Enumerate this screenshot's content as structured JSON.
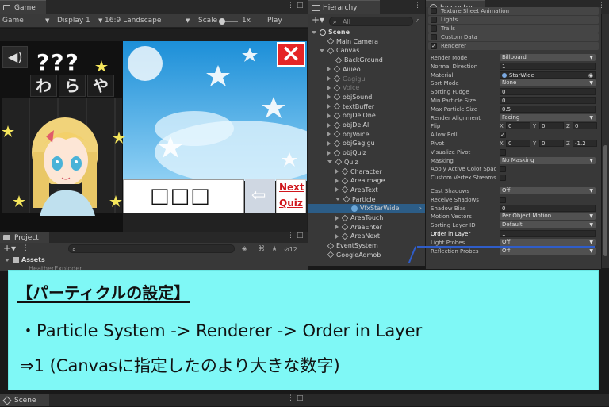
{
  "game": {
    "tab": "Game",
    "mode": "Game",
    "display": "Display 1",
    "aspect": "16:9 Landscape",
    "scale_label": "Scale",
    "scale_value": "1x",
    "play": "Play Focuse",
    "question": "???",
    "kana": [
      "わ",
      "ら",
      "や"
    ],
    "close": "×",
    "box": "□□□",
    "next1": "Next",
    "next2": "Quiz"
  },
  "hierarchy": {
    "tab": "Hierarchy",
    "search": "All",
    "items": [
      {
        "label": "Scene",
        "indent": 0,
        "arrow": "down",
        "icon": "unity",
        "bold": true,
        "dim": false
      },
      {
        "label": "Main Camera",
        "indent": 1,
        "arrow": "",
        "icon": "cube",
        "bold": false,
        "dim": false
      },
      {
        "label": "Canvas",
        "indent": 1,
        "arrow": "down",
        "icon": "cube",
        "bold": false,
        "dim": false
      },
      {
        "label": "BackGround",
        "indent": 2,
        "arrow": "",
        "icon": "cube",
        "bold": false,
        "dim": false
      },
      {
        "label": "Aiueo",
        "indent": 2,
        "arrow": "right",
        "icon": "cube",
        "bold": false,
        "dim": false
      },
      {
        "label": "Gagigu",
        "indent": 2,
        "arrow": "right",
        "icon": "cube",
        "bold": false,
        "dim": true
      },
      {
        "label": "Voice",
        "indent": 2,
        "arrow": "right",
        "icon": "cube",
        "bold": false,
        "dim": true
      },
      {
        "label": "objSound",
        "indent": 2,
        "arrow": "right",
        "icon": "cube",
        "bold": false,
        "dim": false
      },
      {
        "label": "textBuffer",
        "indent": 2,
        "arrow": "right",
        "icon": "cube",
        "bold": false,
        "dim": false
      },
      {
        "label": "objDelOne",
        "indent": 2,
        "arrow": "right",
        "icon": "cube",
        "bold": false,
        "dim": false
      },
      {
        "label": "objDelAll",
        "indent": 2,
        "arrow": "right",
        "icon": "cube",
        "bold": false,
        "dim": false
      },
      {
        "label": "objVoice",
        "indent": 2,
        "arrow": "right",
        "icon": "cube",
        "bold": false,
        "dim": false
      },
      {
        "label": "objGagigu",
        "indent": 2,
        "arrow": "right",
        "icon": "cube",
        "bold": false,
        "dim": false
      },
      {
        "label": "objQuiz",
        "indent": 2,
        "arrow": "right",
        "icon": "cube",
        "bold": false,
        "dim": false
      },
      {
        "label": "Quiz",
        "indent": 2,
        "arrow": "down",
        "icon": "cube",
        "bold": false,
        "dim": false
      },
      {
        "label": "Character",
        "indent": 3,
        "arrow": "right",
        "icon": "cube",
        "bold": false,
        "dim": false
      },
      {
        "label": "AreaImage",
        "indent": 3,
        "arrow": "right",
        "icon": "cube",
        "bold": false,
        "dim": false
      },
      {
        "label": "AreaText",
        "indent": 3,
        "arrow": "right",
        "icon": "cube",
        "bold": false,
        "dim": false
      },
      {
        "label": "Particle",
        "indent": 3,
        "arrow": "down",
        "icon": "cube",
        "bold": false,
        "dim": false
      },
      {
        "label": "VfxStarWide",
        "indent": 4,
        "arrow": "",
        "icon": "particle",
        "bold": false,
        "dim": false,
        "selected": true
      },
      {
        "label": "AreaTouch",
        "indent": 3,
        "arrow": "right",
        "icon": "cube",
        "bold": false,
        "dim": false
      },
      {
        "label": "AreaEnter",
        "indent": 3,
        "arrow": "right",
        "icon": "cube",
        "bold": false,
        "dim": false
      },
      {
        "label": "AreaNext",
        "indent": 3,
        "arrow": "right",
        "icon": "cube",
        "bold": false,
        "dim": false
      },
      {
        "label": "EventSystem",
        "indent": 1,
        "arrow": "",
        "icon": "cube",
        "bold": false,
        "dim": false
      },
      {
        "label": "GoogleAdmob",
        "indent": 1,
        "arrow": "",
        "icon": "cube",
        "bold": false,
        "dim": false
      }
    ]
  },
  "inspector": {
    "tab": "Inspector",
    "modules": [
      {
        "label": "Texture Sheet Animation",
        "checked": false
      },
      {
        "label": "Lights",
        "checked": false
      },
      {
        "label": "Trails",
        "checked": false
      },
      {
        "label": "Custom Data",
        "checked": false
      },
      {
        "label": "Renderer",
        "checked": true
      }
    ],
    "props": [
      {
        "label": "Render Mode",
        "type": "dd",
        "value": "Billboard"
      },
      {
        "label": "Normal Direction",
        "type": "tf",
        "value": "1"
      },
      {
        "label": "Material",
        "type": "obj",
        "value": "StarWide"
      },
      {
        "label": "Sort Mode",
        "type": "dd",
        "value": "None"
      },
      {
        "label": "Sorting Fudge",
        "type": "tf",
        "value": "0"
      },
      {
        "label": "Min Particle Size",
        "type": "tf",
        "value": "0"
      },
      {
        "label": "Max Particle Size",
        "type": "tf",
        "value": "0.5"
      },
      {
        "label": "Render Alignment",
        "type": "dd",
        "value": "Facing"
      },
      {
        "label": "Flip",
        "type": "xyz",
        "x": "0",
        "y": "0",
        "z": "0"
      },
      {
        "label": "Allow Roll",
        "type": "chk",
        "value": "✓"
      },
      {
        "label": "Pivot",
        "type": "xyz",
        "x": "0",
        "y": "0",
        "z": "-1.2"
      },
      {
        "label": "Visualize Pivot",
        "type": "chk",
        "value": ""
      },
      {
        "label": "Masking",
        "type": "dd",
        "value": "No Masking"
      },
      {
        "label": "Apply Active Color Spac",
        "type": "chk",
        "value": ""
      },
      {
        "label": "Custom Vertex Streams",
        "type": "chk",
        "value": ""
      },
      {
        "label": "",
        "type": "gap",
        "value": ""
      },
      {
        "label": "Cast Shadows",
        "type": "dd",
        "value": "Off"
      },
      {
        "label": "Receive Shadows",
        "type": "chk",
        "value": ""
      },
      {
        "label": "Shadow Bias",
        "type": "tf",
        "value": "0"
      },
      {
        "label": "Motion Vectors",
        "type": "dd",
        "value": "Per Object Motion"
      },
      {
        "label": "Sorting Layer ID",
        "type": "dd",
        "value": "Default"
      },
      {
        "label": "Order in Layer",
        "type": "tf",
        "value": "1"
      },
      {
        "label": "Light Probes",
        "type": "dd",
        "value": "Off"
      },
      {
        "label": "Reflection Probes",
        "type": "dd",
        "value": "Off"
      }
    ]
  },
  "project": {
    "tab": "Project",
    "search_count": "12",
    "root": "Assets",
    "partial": "HeatherExploder"
  },
  "scene": {
    "tab": "Scene"
  },
  "overlay": {
    "title": "【パーティクルの設定】",
    "line1": "・Particle System -> Renderer -> Order in Layer",
    "line2": "⇒1 (Canvasに指定したのより大きな数字)"
  },
  "colors": {
    "overlay": "#7ff8f6",
    "accent": "#2f5dc9",
    "selected": "#2c5d87",
    "close": "#e52526",
    "next": "#d0161c"
  }
}
